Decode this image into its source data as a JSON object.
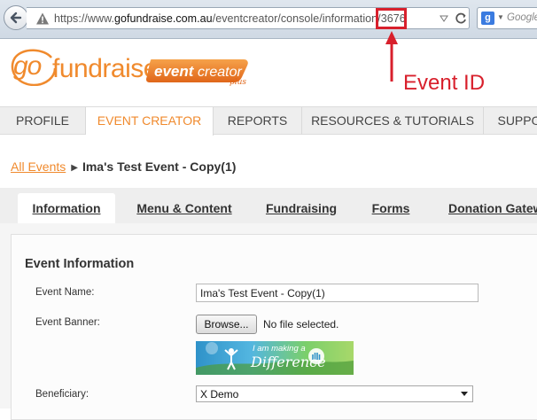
{
  "browser": {
    "url_prefix": "https://www.",
    "url_domain": "gofundraise.com.au",
    "url_path": "/eventcreator/console/information/",
    "url_id": "3676",
    "search_placeholder": "Google"
  },
  "annotation": {
    "label": "Event ID"
  },
  "logo": {
    "go": "go",
    "fundraise": "fundraise",
    "badge_event": "event",
    "badge_creator": "creator",
    "badge_plus": "plus"
  },
  "nav": {
    "items": [
      {
        "label": "PROFILE"
      },
      {
        "label": "EVENT CREATOR"
      },
      {
        "label": "REPORTS"
      },
      {
        "label": "RESOURCES & TUTORIALS"
      },
      {
        "label": "SUPPO"
      }
    ],
    "active": "EVENT CREATOR"
  },
  "breadcrumb": {
    "link": "All Events",
    "separator": "▶",
    "current": "Ima's Test Event - Copy(1)"
  },
  "tabs": {
    "items": [
      {
        "label": "Information"
      },
      {
        "label": "Menu & Content"
      },
      {
        "label": "Fundraising"
      },
      {
        "label": "Forms"
      },
      {
        "label": "Donation Gatew"
      }
    ],
    "active": "Information"
  },
  "form": {
    "section_title": "Event Information",
    "event_name_label": "Event Name:",
    "event_name_value": "Ima's Test Event - Copy(1)",
    "banner_label": "Event Banner:",
    "browse_label": "Browse...",
    "no_file_text": "No file selected.",
    "banner_line1": "I am making a",
    "banner_line2": "Difference",
    "beneficiary_label": "Beneficiary:",
    "beneficiary_value": "X Demo"
  },
  "colors": {
    "brand_orange": "#f08a2d",
    "annotation_red": "#d8202c"
  }
}
